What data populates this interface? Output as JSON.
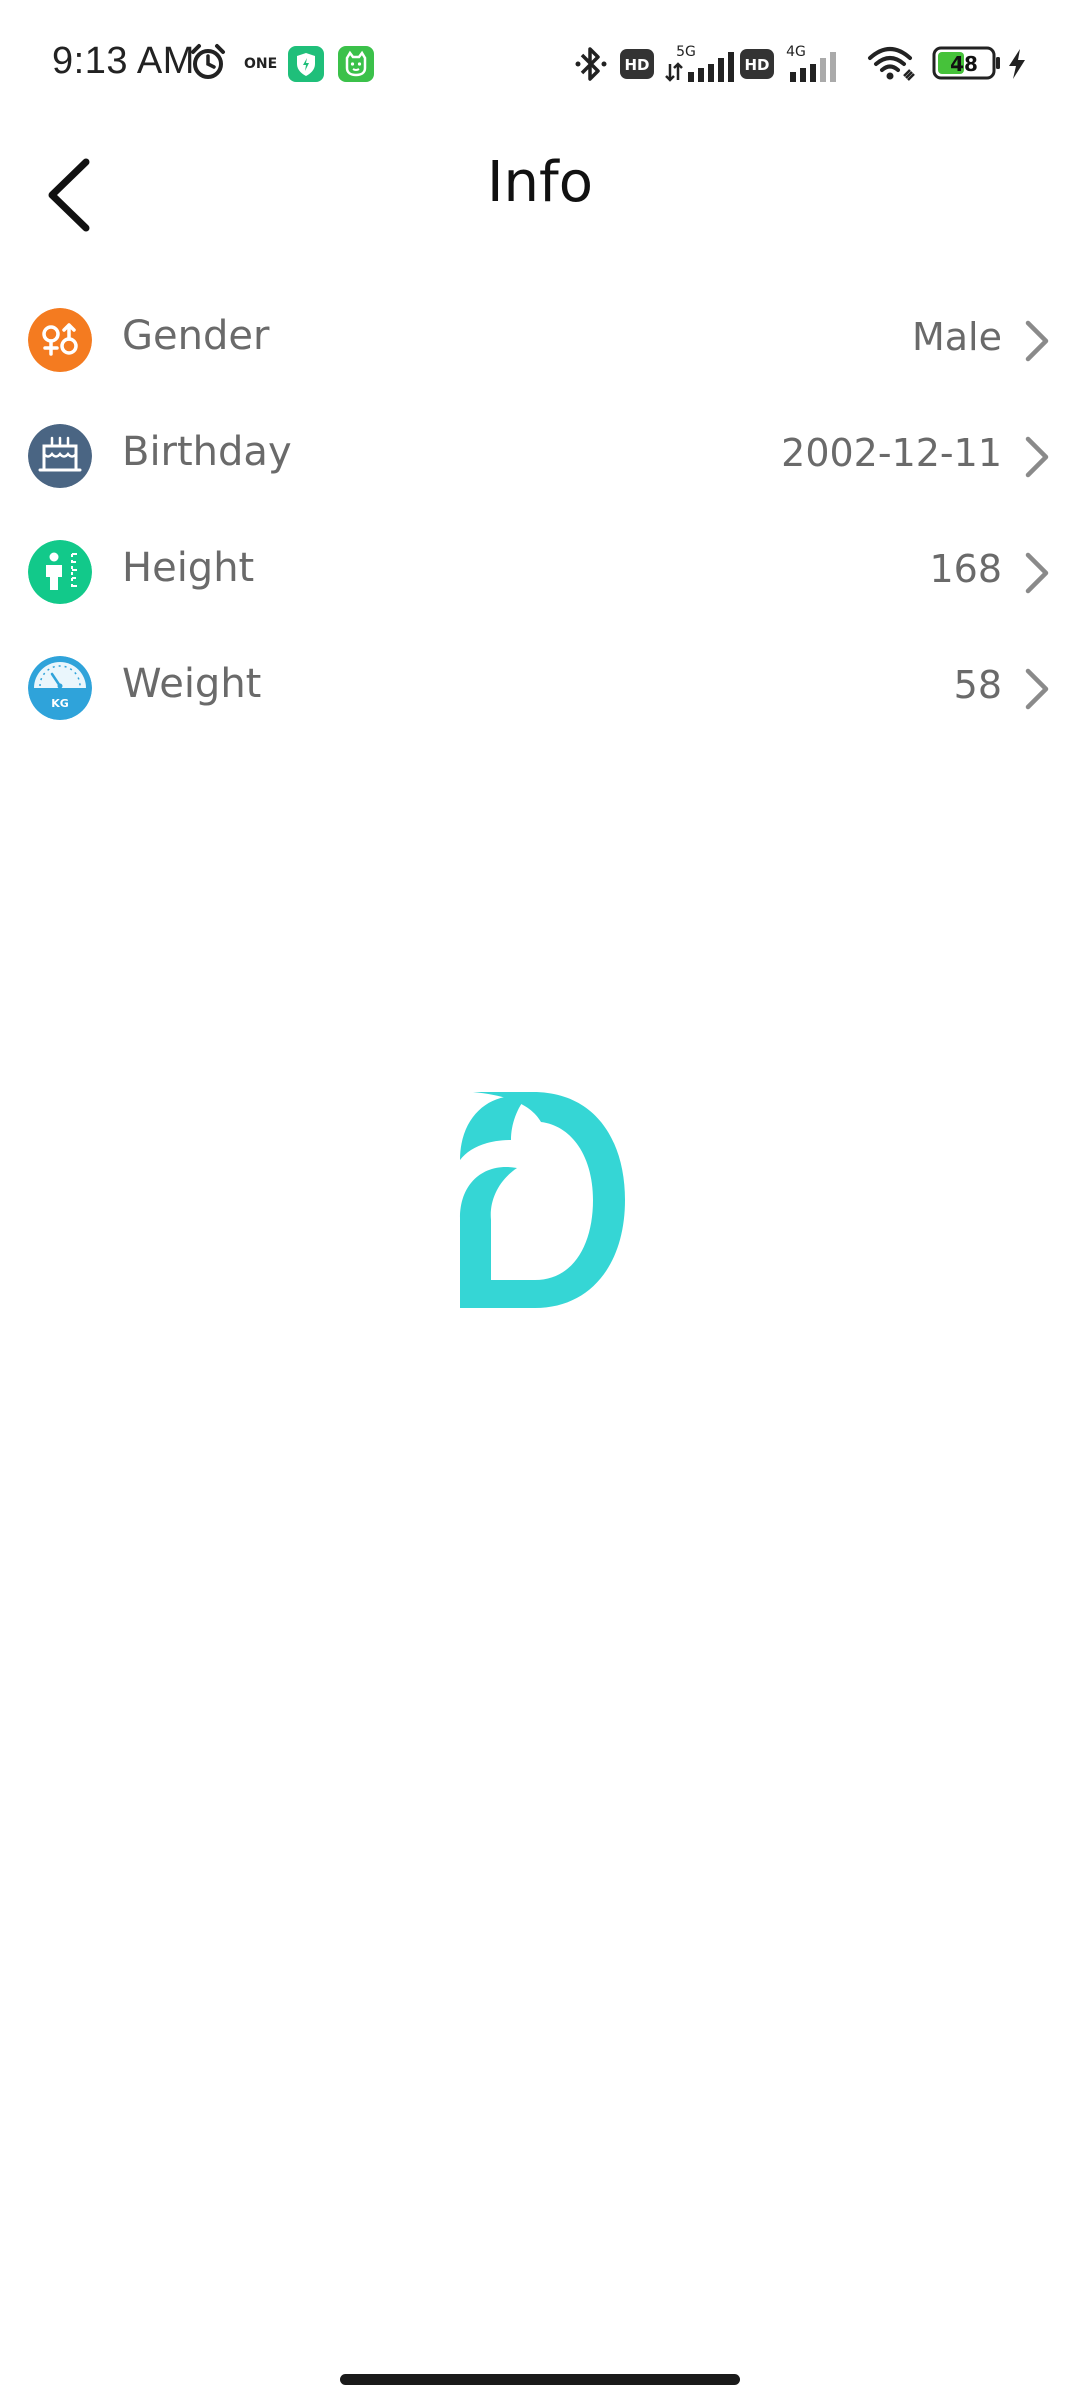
{
  "status_bar": {
    "time": "9:13 AM",
    "one_badge": "ONE",
    "signal_5g": "5G",
    "signal_4g": "4G",
    "hd_label": "HD",
    "battery": "48",
    "icons": [
      "alarm-icon",
      "one-app-icon",
      "shield-app-icon",
      "cat-app-icon",
      "bluetooth-icon",
      "hd-icon",
      "signal-5g-icon",
      "hd-icon",
      "signal-4g-icon",
      "wifi-icon",
      "battery-icon",
      "charging-icon"
    ]
  },
  "header": {
    "title": "Info",
    "back_icon": "chevron-left-icon"
  },
  "rows": [
    {
      "label": "Gender",
      "value": "Male",
      "icon": "gender-icon",
      "color": "#F47B20"
    },
    {
      "label": "Birthday",
      "value": "2002-12-11",
      "icon": "cake-icon",
      "color": "#4A6583"
    },
    {
      "label": "Height",
      "value": "168",
      "icon": "height-icon",
      "color": "#12C98A"
    },
    {
      "label": "Weight",
      "value": "58",
      "icon": "weight-scale-icon",
      "color": "#2FA3DA",
      "icon_text": "KG"
    }
  ],
  "colors": {
    "logo": "#35D6D5",
    "label_text": "#6a6a6a",
    "title_text": "#111111"
  }
}
